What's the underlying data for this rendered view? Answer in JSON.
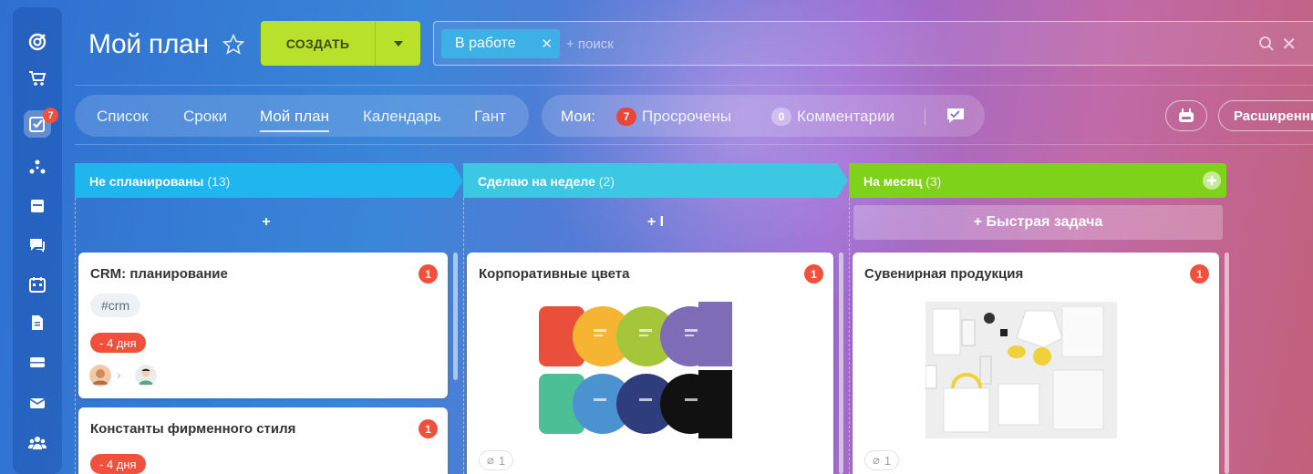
{
  "header": {
    "title": "Мой план",
    "create_label": "СОЗДАТЬ",
    "search": {
      "chip_label": "В работе",
      "placeholder": "+ поиск"
    }
  },
  "rail": {
    "task_badge": "7"
  },
  "views": [
    {
      "label": "Список",
      "active": false
    },
    {
      "label": "Сроки",
      "active": false
    },
    {
      "label": "Мой план",
      "active": true
    },
    {
      "label": "Календарь",
      "active": false
    },
    {
      "label": "Гант",
      "active": false
    }
  ],
  "mine": {
    "label": "Мои:",
    "overdue_count": "7",
    "overdue_label": "Просрочены",
    "comments_count": "0",
    "comments_label": "Комментарии"
  },
  "extended_label": "Расширенный",
  "columns": [
    {
      "title": "Не спланированы",
      "count": "(13)",
      "color": "#1fb6f0",
      "add_label": "+"
    },
    {
      "title": "Сделаю на неделе",
      "count": "(2)",
      "color": "#3cc8e2",
      "add_label": "+ I"
    },
    {
      "title": "На месяц",
      "count": "(3)",
      "color": "#7fd21a",
      "add_label": "+ Быстрая задача"
    }
  ],
  "cards": {
    "crm": {
      "title": "CRM: планирование",
      "badge": "1",
      "tag": "#crm",
      "deadline": "- 4 дня"
    },
    "const": {
      "title": "Константы фирменного стиля",
      "badge": "1",
      "deadline": "- 4 дня"
    },
    "colors": {
      "title": "Корпоративные цвета",
      "badge": "1",
      "attachments": "1"
    },
    "souvenir": {
      "title": "Сувенирная продукция",
      "badge": "1",
      "attachments": "1"
    }
  },
  "palette_colors": [
    "#ea4f3c",
    "#f5b532",
    "#a6c63a",
    "#7e6db6",
    "#4dbf97",
    "#4a93d0",
    "#2f3d7d",
    "#111111"
  ]
}
